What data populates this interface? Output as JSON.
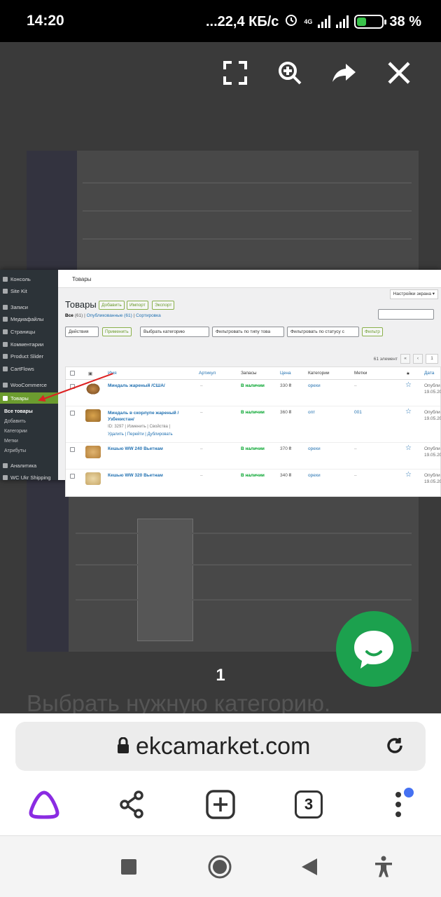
{
  "status_bar": {
    "time": "14:20",
    "network_speed": "...22,4 КБ/с",
    "network_type": "4G",
    "battery": "38 %",
    "battery_level": 0.38
  },
  "viewer": {
    "icons": [
      "fullscreen-icon",
      "zoom-in-icon",
      "share-arrow-icon",
      "close-icon"
    ],
    "page_counter": "1",
    "behind_text": "Выбрать нужную категорию."
  },
  "wp": {
    "top_tab": "Товары",
    "sidebar": {
      "items": [
        "Консоль",
        "Site Kit",
        "Записи",
        "Медиафайлы",
        "Страницы",
        "Комментарии",
        "Product Slider",
        "CartFlows",
        "WooCommerce",
        "Товары"
      ],
      "sub_items": [
        "Все товары",
        "Добавить",
        "Категории",
        "Метки",
        "Атрибуты"
      ],
      "bottom_items": [
        "Аналитика",
        "WC Ukr Shipping"
      ]
    },
    "page_title": "Товары",
    "buttons": [
      "Добавить",
      "Импорт",
      "Экспорт"
    ],
    "screen_options": "Настройки экрана ▾",
    "filters": {
      "all": "Все",
      "all_count": "(61)",
      "published": "Опубликованные (61)",
      "sort": "Сортировка"
    },
    "bulk_action": "Действия",
    "apply": "Применить",
    "category_select": "Выбрать категорию",
    "type_select": "Фильтровать по типу това",
    "stock_select": "Фильтровать по статусу с",
    "filter_button": "Фильтр",
    "pagination": {
      "count": "61 элемент",
      "first": "«",
      "prev": "‹",
      "current": "1"
    },
    "columns": [
      "Имя",
      "Артикул",
      "Запасы",
      "Цена",
      "Категории",
      "Метки",
      "★",
      "Дата"
    ],
    "rows": [
      {
        "name": "Миндаль жареный /США/",
        "sku": "–",
        "stock": "В наличии",
        "price": "330 ₴",
        "category": "орехи",
        "tags": "–",
        "date": "Опубли 19.05.20",
        "actions": "",
        "actions2": ""
      },
      {
        "name": "Миндаль в скорлупе жареный / Узбекистан/",
        "sku": "–",
        "stock": "В наличии",
        "price": "360 ₴",
        "category": "опт",
        "tags": "001",
        "date": "Опубли 19.05.20",
        "actions": "ID: 3297 | Изменить | Свойства |",
        "actions2": "Удалить | Перейти | Дублировать"
      },
      {
        "name": "Кешью WW 240 Вьетнам",
        "sku": "–",
        "stock": "В наличии",
        "price": "370 ₴",
        "category": "орехи",
        "tags": "–",
        "date": "Опубли 19.05.20",
        "actions": "",
        "actions2": ""
      },
      {
        "name": "Кешью WW 320 Вьетнам",
        "sku": "–",
        "stock": "В наличии",
        "price": "340 ₴",
        "category": "орехи",
        "tags": "–",
        "date": "Опубли 19.05.20",
        "actions": "",
        "actions2": ""
      }
    ]
  },
  "browser": {
    "url": "ekcamarket.com",
    "tabs_count": "3",
    "colors": {
      "alice": "#8a2be2",
      "chat": "#1ca14e",
      "notif": "#4571f2"
    }
  }
}
